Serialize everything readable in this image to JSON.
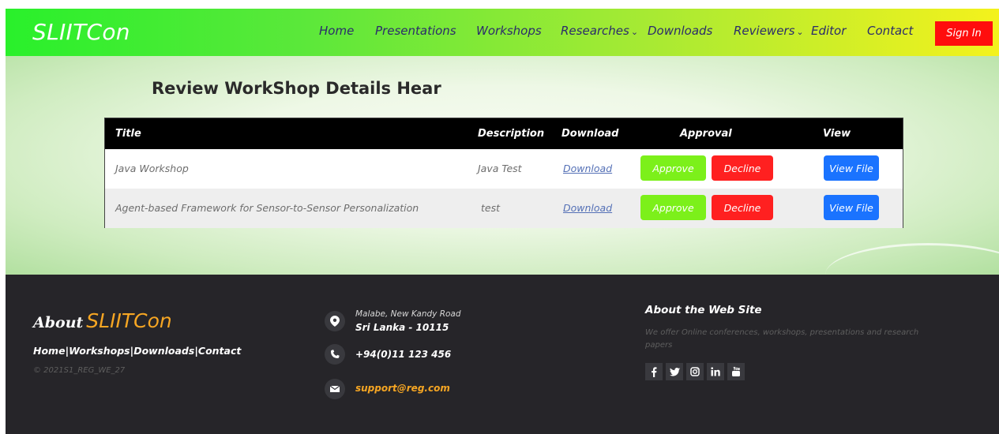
{
  "nav": {
    "brand": "SLIITCon",
    "links": [
      "Home",
      "Presentations",
      "Workshops",
      "Researches",
      "Downloads",
      "Reviewers",
      "Editor",
      "Contact"
    ],
    "signin": "Sign In"
  },
  "main": {
    "heading": "Review WorkShop Details Hear",
    "table": {
      "headers": [
        "Title",
        "Description",
        "Download",
        "Approval",
        "View"
      ],
      "rows": [
        {
          "title": "Java Workshop",
          "description": "Java Test",
          "download": "Download",
          "approve": "Approve",
          "decline": "Decline",
          "view": "View File"
        },
        {
          "title": "Agent-based Framework for Sensor-to-Sensor Personalization",
          "description": "test",
          "download": "Download",
          "approve": "Approve",
          "decline": "Decline",
          "view": "View File"
        }
      ]
    }
  },
  "footer": {
    "about_word": "About",
    "about_brand": "SLIITCon",
    "links": [
      "Home",
      "Workshops",
      "Downloads",
      "Contact"
    ],
    "separator": "|",
    "copyright": "© 2021S1_REG_WE_27",
    "address_line1": "Malabe, New Kandy Road",
    "address_line2": "Sri Lanka - 10115",
    "phone": "+94(0)11 123 456",
    "email": "support@reg.com",
    "about_site_title": "About the Web Site",
    "about_site_text": "We offer Online conferences, workshops, presentations and research papers",
    "social": [
      "facebook-icon",
      "twitter-icon",
      "instagram-icon",
      "linkedin-icon",
      "youtube-icon"
    ]
  },
  "colors": {
    "nav_gradient_start": "#29f02b",
    "nav_gradient_end": "#f4f21c",
    "signin": "#ff0d0d",
    "approve": "#7cf01a",
    "decline": "#ff2020",
    "view": "#1a73ff",
    "footer_bg": "#262529",
    "accent": "#f6a623"
  }
}
